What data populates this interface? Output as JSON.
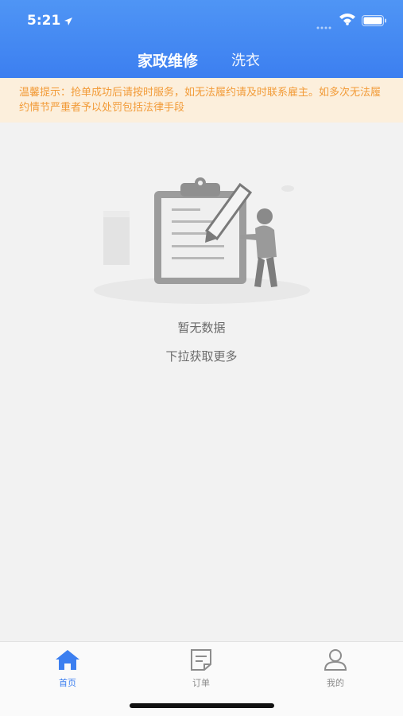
{
  "status_bar": {
    "time": "5:21",
    "icons": [
      "location-arrow-icon",
      "signal-icon",
      "wifi-icon",
      "battery-icon"
    ]
  },
  "header": {
    "tabs": [
      {
        "label": "家政维修",
        "active": true
      },
      {
        "label": "洗衣",
        "active": false
      }
    ],
    "accent_color": "#3c7ff0"
  },
  "notice": {
    "text": "温馨提示：抢单成功后请按时服务，如无法履约请及时联系雇主。如多次无法履约情节严重者予以处罚包括法律手段",
    "color": "#f29b38",
    "background": "#fcefdc"
  },
  "empty_state": {
    "illustration": "clipboard-pencil-person-illustration",
    "title": "暂无数据",
    "hint": "下拉获取更多"
  },
  "tabbar": {
    "items": [
      {
        "label": "首页",
        "icon": "home-icon",
        "active": true
      },
      {
        "label": "订单",
        "icon": "order-icon",
        "active": false
      },
      {
        "label": "我的",
        "icon": "user-icon",
        "active": false
      }
    ],
    "active_color": "#3c7ff0",
    "inactive_color": "#8c8c8c"
  }
}
